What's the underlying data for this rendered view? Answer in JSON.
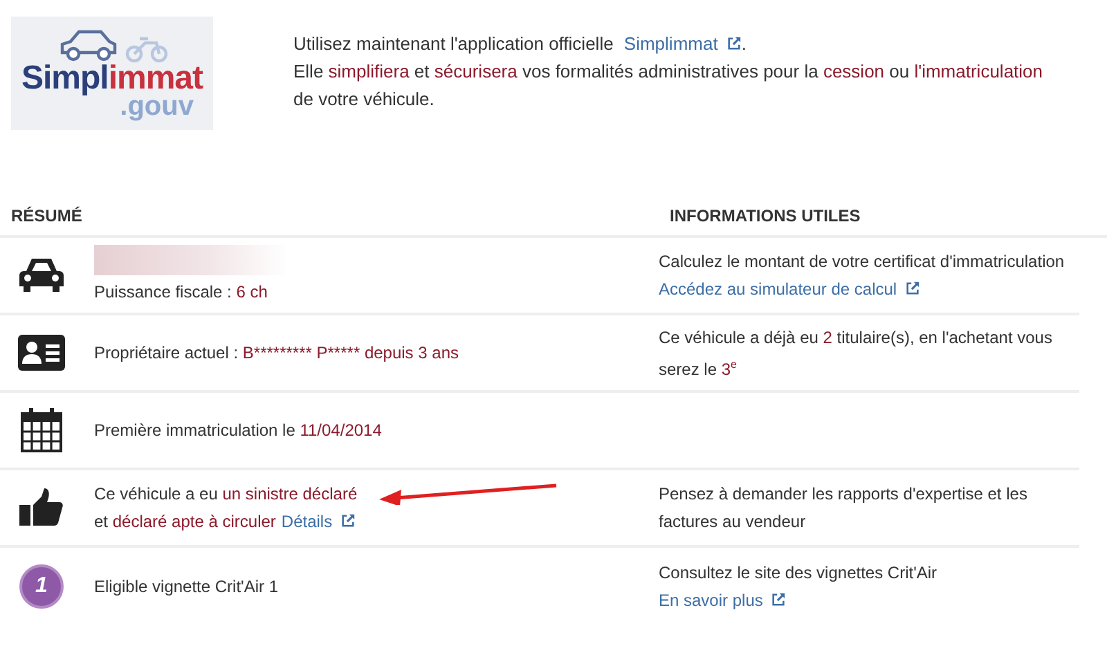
{
  "banner": {
    "logo": {
      "name_start": "Simpl",
      "name_end": "immat",
      "suffix": ".gouv"
    },
    "lines": [
      [
        {
          "kind": "plain",
          "text": "Utilisez maintenant l'application officielle "
        },
        {
          "kind": "link",
          "text": "Simplimmat"
        },
        {
          "kind": "plain",
          "text": "."
        }
      ],
      [
        {
          "kind": "plain",
          "text": "Elle "
        },
        {
          "kind": "highlight",
          "text": "simplifiera"
        },
        {
          "kind": "plain",
          "text": " et "
        },
        {
          "kind": "highlight",
          "text": "sécurisera"
        },
        {
          "kind": "plain",
          "text": " vos formalités administratives pour la "
        },
        {
          "kind": "highlight",
          "text": "cession"
        },
        {
          "kind": "plain",
          "text": " ou "
        },
        {
          "kind": "highlight",
          "text": "l'immatriculation"
        }
      ],
      [
        {
          "kind": "plain",
          "text": "de votre véhicule."
        }
      ]
    ]
  },
  "headers": {
    "summary": "RÉSUMÉ",
    "info": "INFORMATIONS UTILES"
  },
  "rows": [
    {
      "summary": [
        [
          {
            "kind": "plain",
            "text": "Puissance fiscale : "
          },
          {
            "kind": "highlight",
            "text": "6 ch"
          }
        ]
      ],
      "info": [
        [
          {
            "kind": "plain",
            "text": "Calculez le montant de votre certificat d'immatriculation"
          }
        ],
        [
          {
            "kind": "link",
            "text": "Accédez au simulateur de calcul"
          }
        ]
      ]
    },
    {
      "summary": [
        [
          {
            "kind": "plain",
            "text": "Propriétaire actuel : "
          },
          {
            "kind": "highlight",
            "text": "B********* P***** depuis 3 ans"
          }
        ]
      ],
      "info": [
        [
          {
            "kind": "plain",
            "text": "Ce véhicule a déjà eu "
          },
          {
            "kind": "highlight",
            "text": "2"
          },
          {
            "kind": "plain",
            "text": " titulaire(s), en l'achetant vous serez le "
          },
          {
            "kind": "highlight",
            "text": "3",
            "sup": "e"
          }
        ]
      ]
    },
    {
      "summary": [
        [
          {
            "kind": "plain",
            "text": "Première immatriculation le "
          },
          {
            "kind": "highlight",
            "text": "11/04/2014"
          }
        ]
      ],
      "info": []
    },
    {
      "summary": [
        [
          {
            "kind": "plain",
            "text": "Ce véhicule a eu "
          },
          {
            "kind": "highlight",
            "text": "un sinistre déclaré"
          }
        ],
        [
          {
            "kind": "plain",
            "text": "et "
          },
          {
            "kind": "highlight",
            "text": "déclaré apte à circuler"
          },
          {
            "kind": "link",
            "text": "Détails"
          }
        ]
      ],
      "info": [
        [
          {
            "kind": "plain",
            "text": "Pensez à demander les rapports d'expertise et les factures au vendeur"
          }
        ]
      ]
    },
    {
      "badge": "1",
      "summary": [
        [
          {
            "kind": "plain",
            "text": "Eligible vignette Crit'Air 1"
          }
        ]
      ],
      "info": [
        [
          {
            "kind": "plain",
            "text": "Consultez le site des vignettes Crit'Air"
          }
        ],
        [
          {
            "kind": "link",
            "text": "En savoir plus"
          }
        ]
      ]
    }
  ]
}
